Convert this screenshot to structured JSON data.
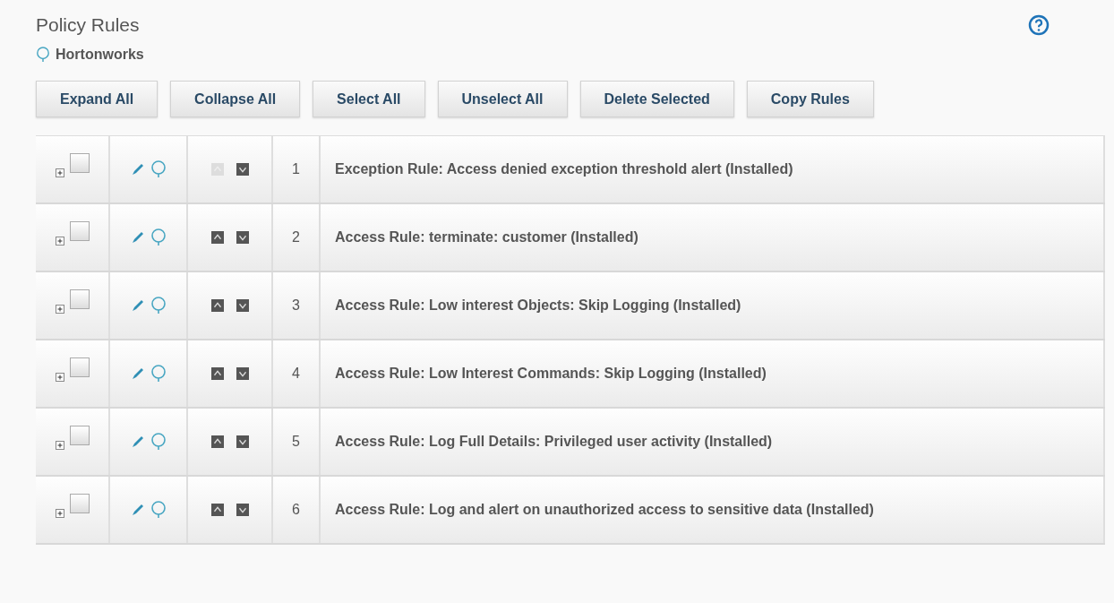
{
  "title": "Policy Rules",
  "policy": {
    "name": "Hortonworks"
  },
  "buttons": [
    "Expand All",
    "Collapse All",
    "Select All",
    "Unselect All",
    "Delete Selected",
    "Copy Rules"
  ],
  "rules": [
    {
      "number": "1",
      "text": "Exception Rule: Access denied exception threshold alert (Installed)",
      "checked": false,
      "up_disabled": true
    },
    {
      "number": "2",
      "text": "Access Rule: terminate: customer (Installed)",
      "checked": false,
      "up_disabled": false
    },
    {
      "number": "3",
      "text": "Access Rule: Low interest Objects: Skip Logging (Installed)",
      "checked": false,
      "up_disabled": false
    },
    {
      "number": "4",
      "text": "Access Rule: Low Interest Commands: Skip Logging (Installed)",
      "checked": false,
      "up_disabled": false
    },
    {
      "number": "5",
      "text": "Access Rule: Log Full Details: Privileged user activity (Installed)",
      "checked": false,
      "up_disabled": false
    },
    {
      "number": "6",
      "text": "Access Rule: Log and alert on unauthorized access to sensitive data (Installed)",
      "checked": false,
      "up_disabled": false
    }
  ]
}
